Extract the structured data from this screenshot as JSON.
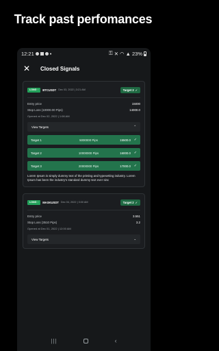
{
  "headline": "Track past perfomances",
  "status": {
    "time": "12:21",
    "battery": "23%"
  },
  "appbar": {
    "title": "Closed Signals",
    "close_icon": "close-icon"
  },
  "signals": [
    {
      "direction": "LONG ↑",
      "pair": "BTCUSDT",
      "date": "Dec 03, 2022 | 3:21 AM",
      "target_badge": "Target 3",
      "entry_label": "Entry price",
      "entry_value": "15000",
      "stop_label": "Stop Loss  (10000.00 Pips)",
      "stop_value": "14000.0",
      "opened": "Opened at Dec 02, 2022 | 1:08 AM",
      "view_targets": "View Targets",
      "expanded": true,
      "targets": [
        {
          "name": "Target 1",
          "pips": "5000000 Pips",
          "value": "15500.0"
        },
        {
          "name": "Target 2",
          "pips": "10000000 Pips",
          "value": "16000.0"
        },
        {
          "name": "Target 3",
          "pips": "20000000 Pips",
          "value": "17000.0"
        }
      ],
      "description": "Lorem Ipsum is simply dummy text of the printing and typesetting industry. Lorem Ipsum has been the industry's standard dummy text ever sinc"
    },
    {
      "direction": "LONG ↑",
      "pair": "MASKUSDT",
      "date": "Dec 04, 2022 | 3:00 AM",
      "target_badge": "Target 2",
      "entry_label": "Entry price",
      "entry_value": "3.551",
      "stop_label": "Stop Loss  (3510 Pips)",
      "stop_value": "3.2",
      "opened": "Opened at Dec 01, 2022 | 12:00 AM",
      "view_targets": "View Targets",
      "expanded": false
    }
  ],
  "colors": {
    "accent": "#23a05a",
    "target_row": "#23744c",
    "card_bg": "#1b1d20",
    "screen_bg": "#16181a"
  }
}
